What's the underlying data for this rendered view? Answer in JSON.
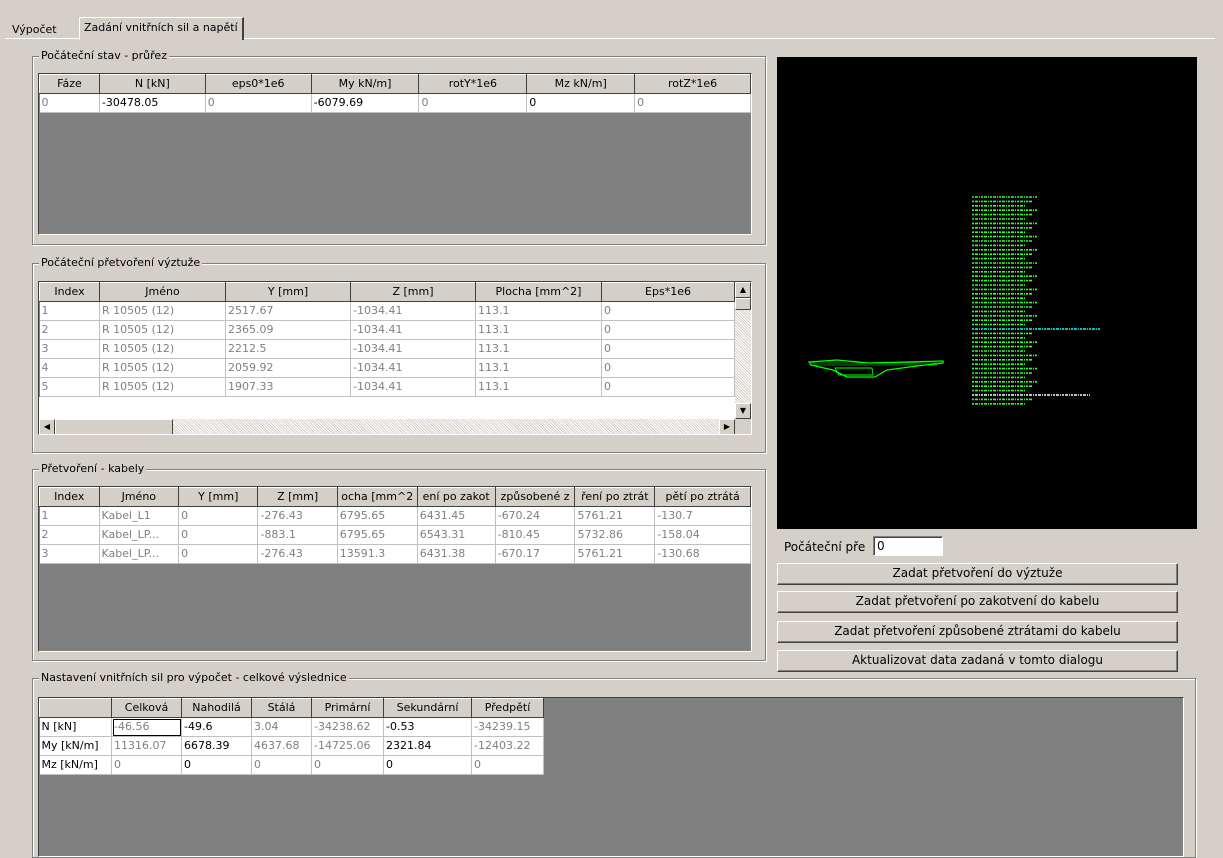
{
  "tabs": [
    "Výpočet",
    "Zadání vnitřních sil a napětí"
  ],
  "initial_state": {
    "title": "Počáteční stav - průřez",
    "columns": [
      "Fáze",
      "N [kN]",
      "eps0*1e6",
      "My kN/m]",
      "rotY*1e6",
      "Mz kN/m]",
      "rotZ*1e6"
    ],
    "rows": [
      [
        "0",
        "-30478.05",
        "0",
        "-6079.69",
        "0",
        "0",
        "0"
      ]
    ]
  },
  "reinforcement": {
    "title": "Počáteční přetvoření výztuže",
    "columns": [
      "Index",
      "Jméno",
      "Y [mm]",
      "Z [mm]",
      "Plocha [mm^2]",
      "Eps*1e6"
    ],
    "rows": [
      [
        "1",
        "R 10505 (12)",
        "2517.67",
        "-1034.41",
        "113.1",
        "0"
      ],
      [
        "2",
        "R 10505 (12)",
        "2365.09",
        "-1034.41",
        "113.1",
        "0"
      ],
      [
        "3",
        "R 10505 (12)",
        "2212.5",
        "-1034.41",
        "113.1",
        "0"
      ],
      [
        "4",
        "R 10505 (12)",
        "2059.92",
        "-1034.41",
        "113.1",
        "0"
      ],
      [
        "5",
        "R 10505 (12)",
        "1907.33",
        "-1034.41",
        "113.1",
        "0"
      ]
    ]
  },
  "cables": {
    "title": "Přetvoření - kabely",
    "columns": [
      "Index",
      "Jméno",
      "Y [mm]",
      "Z [mm]",
      "ocha [mm^2",
      "ení po zakot",
      "způsobené z",
      "ření po ztrát",
      "pětí po ztrátá"
    ],
    "rows": [
      [
        "1",
        "Kabel_L1",
        "0",
        "-276.43",
        "6795.65",
        "6431.45",
        "-670.24",
        "5761.21",
        "-130.7"
      ],
      [
        "2",
        "Kabel_LP...",
        "0",
        "-883.1",
        "6795.65",
        "6543.31",
        "-810.45",
        "5732.86",
        "-158.04"
      ],
      [
        "3",
        "Kabel_LP...",
        "0",
        "-276.43",
        "13591.3",
        "6431.38",
        "-670.17",
        "5761.21",
        "-130.68"
      ]
    ]
  },
  "initial_strain_label": "Počáteční pře",
  "initial_strain_value": "0",
  "buttons": {
    "b1": "Zadat přetvoření do výztuže",
    "b2": "Zadat přetvoření po zakotvení do kabelu",
    "b3": "Zadat přetvoření způsobené ztrátami do kabelu",
    "b4": "Aktualizovat data zadaná v tomto dialogu"
  },
  "forces": {
    "title": "Nastavení vnitřních sil pro výpočet - celkové výslednice",
    "columns": [
      "",
      "Celková",
      "Nahodilá",
      "Stálá",
      "Primární",
      "Sekundární",
      "Předpětí"
    ],
    "rows": [
      [
        "N [kN]",
        "-46.56",
        "-49.6",
        "3.04",
        "-34238.62",
        "-0.53",
        "-34239.15"
      ],
      [
        "My [kN/m]",
        "11316.07",
        "6678.39",
        "4637.68",
        "-14725.06",
        "2321.84",
        "-12403.22"
      ],
      [
        "Mz [kN/m]",
        "0",
        "0",
        "0",
        "0",
        "0",
        "0"
      ]
    ]
  },
  "preview_colors": {
    "background": "#000000",
    "section": "#00ff00",
    "labels_green": "#33ff33",
    "labels_cyan": "#00ffff",
    "labels_white": "#ffffff"
  }
}
